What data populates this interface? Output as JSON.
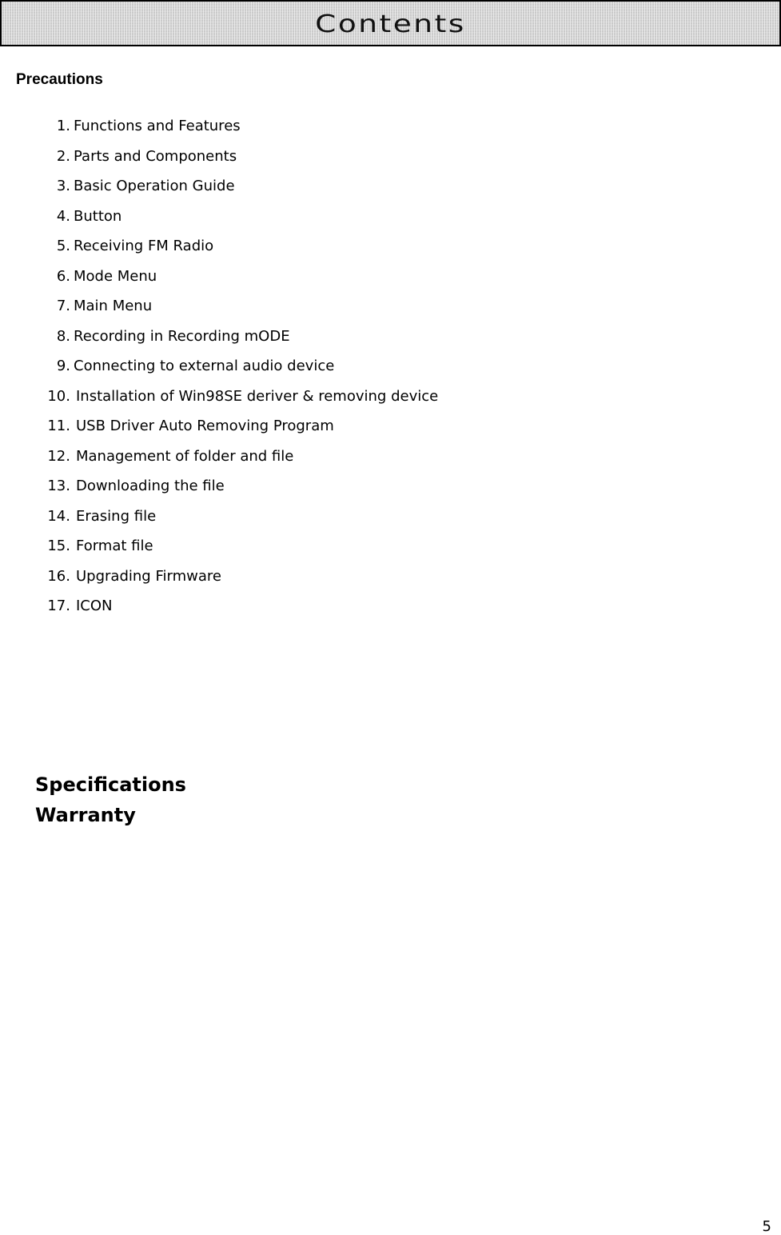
{
  "header": {
    "title": "Contents"
  },
  "sections": {
    "precautions": "Precautions",
    "toc": [
      {
        "num": "1.",
        "label": "Functions and Features"
      },
      {
        "num": "2.",
        "label": "Parts and Components"
      },
      {
        "num": "3.",
        "label": "Basic Operation Guide"
      },
      {
        "num": "4.",
        "label": "Button"
      },
      {
        "num": "5.",
        "label": "Receiving FM Radio"
      },
      {
        "num": "6.",
        "label": "Mode Menu"
      },
      {
        "num": "7.",
        "label": "Main Menu"
      },
      {
        "num": "8.",
        "label": "Recording in Recording mODE"
      },
      {
        "num": "9.",
        "label": "Connecting to external audio device"
      },
      {
        "num": "10.",
        "label": "Installation of Win98SE deriver & removing device"
      },
      {
        "num": "11.",
        "label": "USB Driver Auto Removing Program"
      },
      {
        "num": "12.",
        "label": "Management of folder and file"
      },
      {
        "num": "13.",
        "label": "Downloading the file"
      },
      {
        "num": "14.",
        "label": "Erasing file"
      },
      {
        "num": "15.",
        "label": "Format file"
      },
      {
        "num": "16.",
        "label": "Upgrading Firmware"
      },
      {
        "num": "17.",
        "label": "ICON"
      }
    ],
    "specifications": "Specifications",
    "warranty": "Warranty"
  },
  "footer": {
    "page_number": "5"
  }
}
